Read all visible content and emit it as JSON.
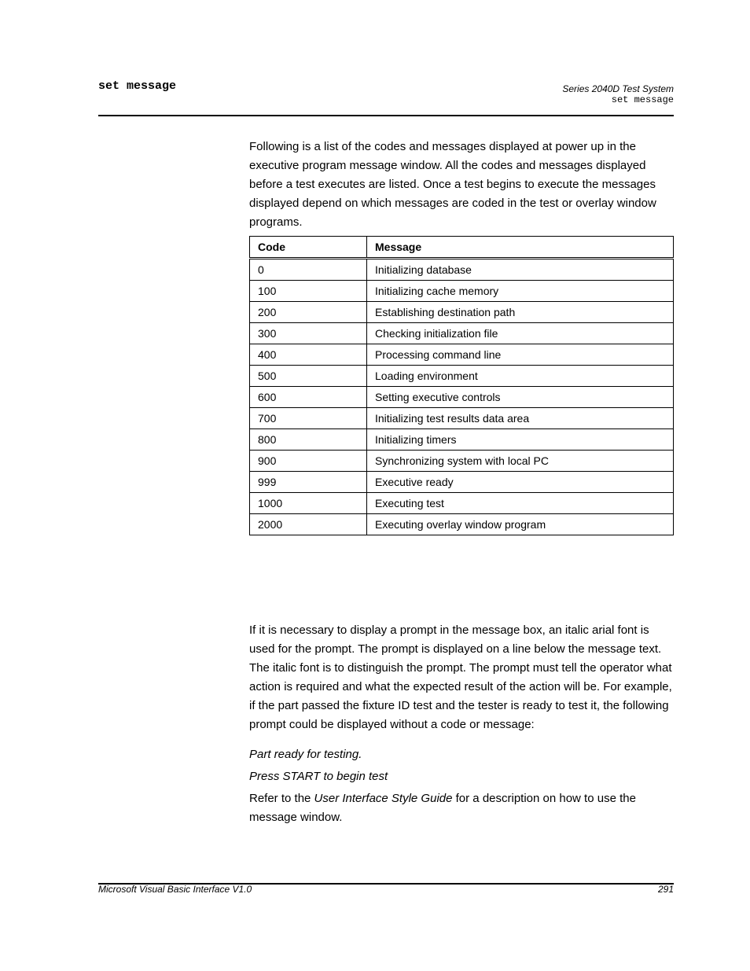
{
  "header": {
    "left_label": "set message",
    "right_line1": "Series 2040D Test System",
    "right_line2": "set message"
  },
  "intro": {
    "p1": "Following is a list of the codes and messages displayed at power up in the executive program message window. All the codes and messages displayed before a test executes are listed. Once a test begins to execute the messages displayed depend on which messages are coded in the test or overlay window programs."
  },
  "table": {
    "headers": [
      "Code",
      "Message"
    ],
    "rows": [
      [
        "0",
        "Initializing database"
      ],
      [
        "100",
        "Initializing cache memory"
      ],
      [
        "200",
        "Establishing destination path"
      ],
      [
        "300",
        "Checking initialization file"
      ],
      [
        "400",
        "Processing command line"
      ],
      [
        "500",
        "Loading environment"
      ],
      [
        "600",
        "Setting executive controls"
      ],
      [
        "700",
        "Initializing test results data area"
      ],
      [
        "800",
        "Initializing timers"
      ],
      [
        "900",
        "Synchronizing system with local PC"
      ],
      [
        "999",
        "Executive ready"
      ],
      [
        "1000",
        "Executing test"
      ],
      [
        "2000",
        "Executing overlay window program"
      ]
    ]
  },
  "closing": {
    "p1_a": "If it is necessary to display a prompt in the message box, an italic arial font is used for the prompt. The prompt is displayed on a line below the message text. The italic font is to distinguish the prompt. The prompt must tell the operator what action is required and what the expected result of the action will be. For example, if the part passed the fixture ID test and the tester is ready to test it, the following prompt could be displayed without a code or message:",
    "prompt_lines": [
      "Part ready for testing.",
      "Press START to begin test"
    ],
    "p2_a": "Refer to the ",
    "p2_i": "User Interface Style Guide",
    "p2_b": " for a description on how to use the message window."
  },
  "footer": {
    "left": "Microsoft Visual Basic Interface  V1.0",
    "right": "291"
  }
}
